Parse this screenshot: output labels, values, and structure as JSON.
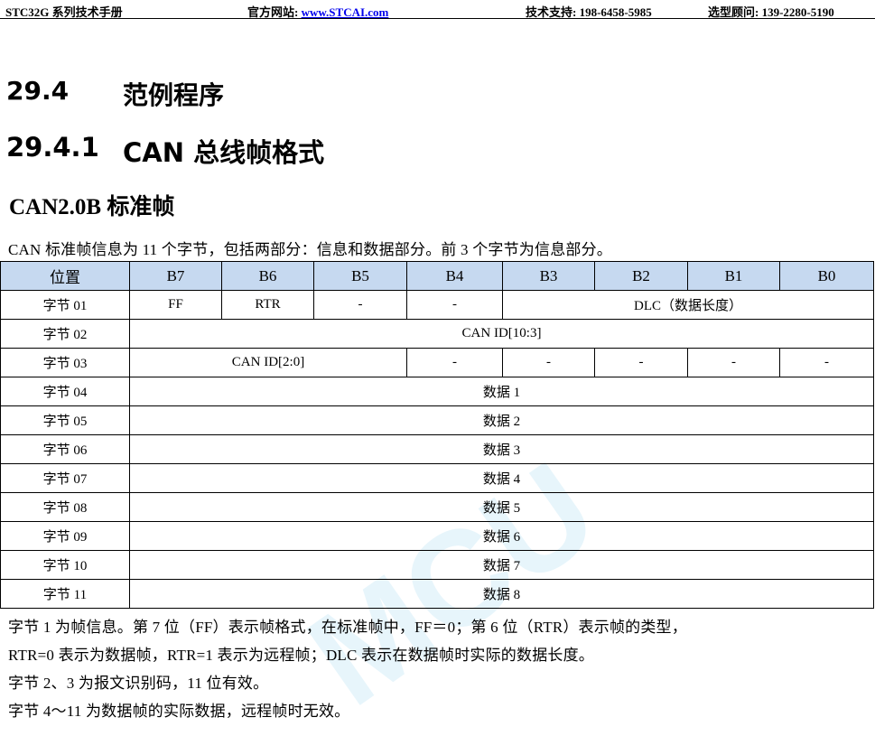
{
  "header": {
    "manual": "STC32G 系列技术手册",
    "site_label": "官方网站: ",
    "site_link": "www.STCAI.com",
    "support": "技术支持: 198-6458-5985",
    "consult": "选型顾问: 139-2280-5190"
  },
  "section": {
    "num": "29.4",
    "title": "范例程序"
  },
  "subsection": {
    "num": "29.4.1",
    "title": "CAN 总线帧格式"
  },
  "subhead": "CAN2.0B  标准帧",
  "intro": "CAN  标准帧信息为  11  个字节，包括两部分：信息和数据部分。前  3  个字节为信息部分。",
  "table": {
    "headers": [
      "位置",
      "B7",
      "B6",
      "B5",
      "B4",
      "B3",
      "B2",
      "B1",
      "B0"
    ],
    "row1": {
      "label": "字节 01",
      "ff": "FF",
      "rtr": "RTR",
      "b5": "-",
      "b4": "-",
      "dlc": "DLC（数据长度）"
    },
    "row2": {
      "label": "字节 02",
      "value": "CAN ID[10:3]"
    },
    "row3": {
      "label": "字节 03",
      "id": "CAN ID[2:0]",
      "b4": "-",
      "b3": "-",
      "b2": "-",
      "b1": "-",
      "b0": "-"
    },
    "data_rows": [
      {
        "label": "字节 04",
        "value": "数据 1"
      },
      {
        "label": "字节 05",
        "value": "数据 2"
      },
      {
        "label": "字节 06",
        "value": "数据 3"
      },
      {
        "label": "字节 07",
        "value": "数据 4"
      },
      {
        "label": "字节 08",
        "value": "数据 5"
      },
      {
        "label": "字节 09",
        "value": "数据 6"
      },
      {
        "label": "字节 10",
        "value": "数据 7"
      },
      {
        "label": "字节 11",
        "value": "数据 8"
      }
    ]
  },
  "notes": [
    "字节  1  为帧信息。第  7  位（FF）表示帧格式，在标准帧中，FF＝0；第  6  位（RTR）表示帧的类型，",
    "RTR=0  表示为数据帧，RTR=1  表示为远程帧；DLC  表示在数据帧时实际的数据长度。",
    "字节  2、3  为报文识别码，11  位有效。",
    "字节  4～11  为数据帧的实际数据，远程帧时无效。"
  ],
  "watermark": "MCU"
}
